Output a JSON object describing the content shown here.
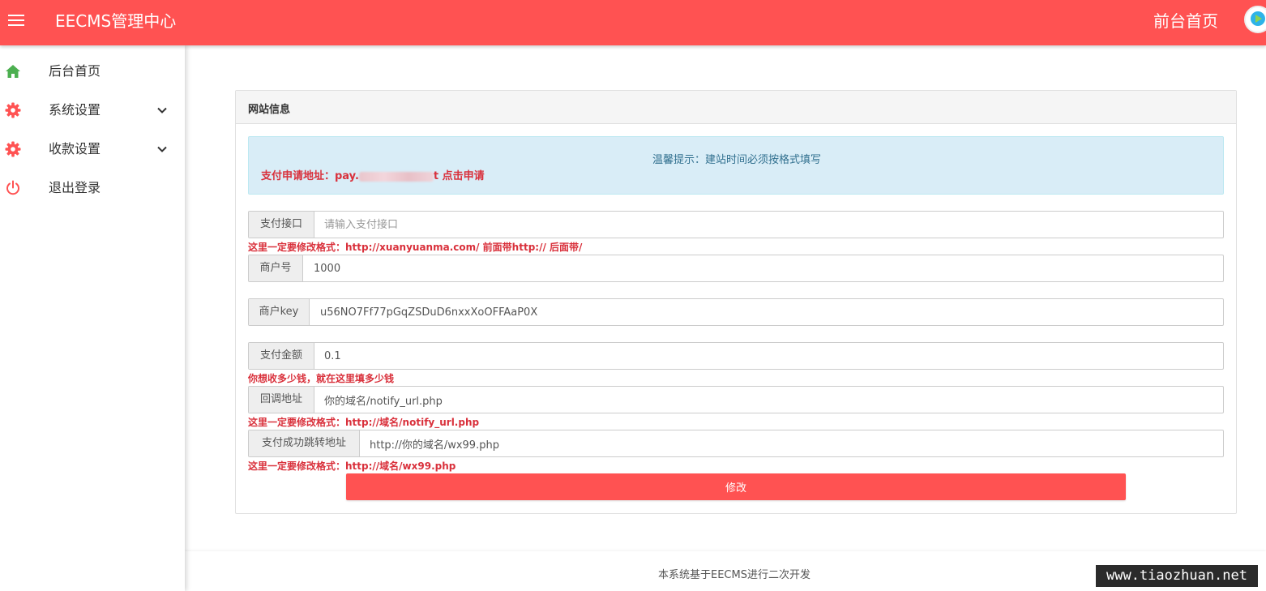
{
  "header": {
    "title": "EECMS管理中心",
    "front_link": "前台首页"
  },
  "sidebar": {
    "items": [
      {
        "label": "后台首页",
        "icon": "home-icon",
        "color": "#4caf50"
      },
      {
        "label": "系统设置",
        "icon": "gear-icon",
        "color": "#ff5252"
      },
      {
        "label": "收款设置",
        "icon": "gear-icon",
        "color": "#ff5252"
      },
      {
        "label": "退出登录",
        "icon": "power-icon",
        "color": "#ff5252"
      }
    ]
  },
  "panel": {
    "title": "网站信息",
    "alert_tip": "温馨提示：建站时间必须按格式填写",
    "alert_link_prefix": "支付申请地址：pay.",
    "alert_link_suffix": "t 点击申请"
  },
  "form": {
    "api": {
      "label": "支付接口",
      "value": "",
      "placeholder": "请输入支付接口",
      "hint": "这里一定要修改格式：http://xuanyuanma.com/ 前面带http:// 后面带/"
    },
    "merchant_id": {
      "label": "商户号",
      "value": "1000"
    },
    "merchant_key": {
      "label": "商户key",
      "value": "u56NO7Ff77pGqZSDuD6nxxXoOFFAaP0X"
    },
    "amount": {
      "label": "支付金额",
      "value": "0.1",
      "hint": "你想收多少钱，就在这里填多少钱"
    },
    "notify_url": {
      "label": "回调地址",
      "value": "你的域名/notify_url.php",
      "hint": "这里一定要修改格式：http://域名/notify_url.php"
    },
    "return_url": {
      "label": "支付成功跳转地址",
      "value": "http://你的域名/wx99.php",
      "hint": "这里一定要修改格式：http://域名/wx99.php"
    },
    "submit_label": "修改"
  },
  "footer": {
    "text": "本系统基于EECMS进行二次开发"
  },
  "watermark": "www.tiaozhuan.net",
  "colors": {
    "accent": "#ff5252",
    "alert_bg": "#d9edf7",
    "hint_red": "#d9303b"
  }
}
